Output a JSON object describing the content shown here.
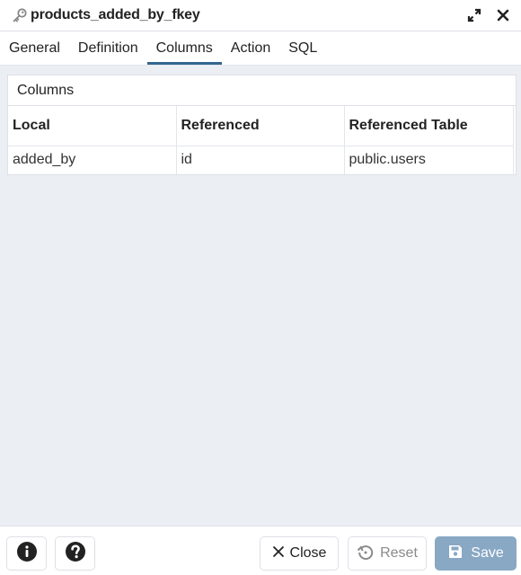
{
  "dialog": {
    "title": "products_added_by_fkey",
    "icons": {
      "title": "key-icon",
      "maximize": "maximize-icon",
      "close": "close-icon"
    }
  },
  "tabs": [
    {
      "label": "General",
      "active": false
    },
    {
      "label": "Definition",
      "active": false
    },
    {
      "label": "Columns",
      "active": true
    },
    {
      "label": "Action",
      "active": false
    },
    {
      "label": "SQL",
      "active": false
    }
  ],
  "columns_panel": {
    "header": "Columns",
    "table": {
      "headers": [
        "Local",
        "Referenced",
        "Referenced Table"
      ],
      "rows": [
        [
          "added_by",
          "id",
          "public.users"
        ]
      ]
    }
  },
  "footer": {
    "info_icon": "info-icon",
    "help_icon": "help-icon",
    "close_label": "Close",
    "reset_label": "Reset",
    "save_label": "Save"
  },
  "colors": {
    "accent": "#326690",
    "save_button": "#88a8c4",
    "content_bg": "#ebeef3"
  }
}
